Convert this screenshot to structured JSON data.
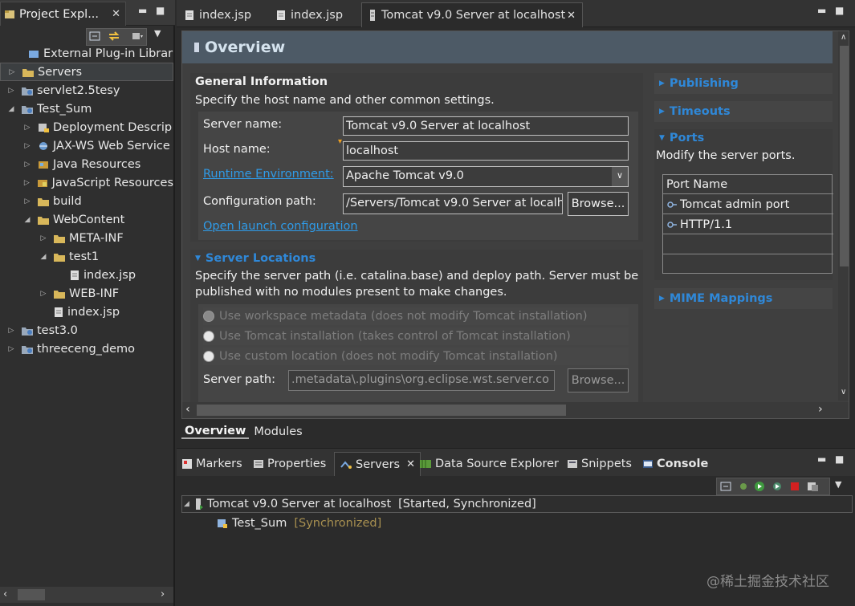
{
  "left_panel": {
    "tab_title": "Project Expl...",
    "tree": [
      {
        "label": "External Plug-in Librarie",
        "icon": "library-icon",
        "arrow": ""
      },
      {
        "label": "Servers",
        "icon": "folder-icon",
        "arrow": "▷",
        "selected": true
      },
      {
        "label": "servlet2.5tesy",
        "icon": "web-project-icon",
        "arrow": "▷"
      },
      {
        "label": "Test_Sum",
        "icon": "web-project-icon",
        "arrow": "◢"
      },
      {
        "label": "Deployment Descrip",
        "icon": "deployment-icon",
        "arrow": "▷"
      },
      {
        "label": "JAX-WS Web Service",
        "icon": "webservice-icon",
        "arrow": "▷"
      },
      {
        "label": "Java Resources",
        "icon": "java-resources-icon",
        "arrow": "▷"
      },
      {
        "label": "JavaScript Resources",
        "icon": "js-resources-icon",
        "arrow": "▷"
      },
      {
        "label": "build",
        "icon": "folder-icon",
        "arrow": "▷"
      },
      {
        "label": "WebContent",
        "icon": "folder-icon",
        "arrow": "◢"
      },
      {
        "label": "META-INF",
        "icon": "folder-icon",
        "arrow": "▷"
      },
      {
        "label": "test1",
        "icon": "folder-icon",
        "arrow": "◢"
      },
      {
        "label": "index.jsp",
        "icon": "jsp-file-icon",
        "arrow": ""
      },
      {
        "label": "WEB-INF",
        "icon": "folder-icon",
        "arrow": "▷"
      },
      {
        "label": "index.jsp",
        "icon": "jsp-file-icon",
        "arrow": ""
      },
      {
        "label": "test3.0",
        "icon": "web-project-icon",
        "arrow": "▷"
      },
      {
        "label": "threeceng_demo",
        "icon": "web-project-icon",
        "arrow": "▷"
      }
    ]
  },
  "editor": {
    "tabs": [
      {
        "label": "index.jsp"
      },
      {
        "label": "index.jsp"
      },
      {
        "label": "Tomcat v9.0 Server at localhost",
        "active": true
      }
    ],
    "overview_title": "Overview",
    "general": {
      "title": "General Information",
      "desc": "Specify the host name and other common settings.",
      "server_name_label": "Server name:",
      "server_name_value": "Tomcat v9.0 Server at localhost",
      "host_name_label": "Host name:",
      "host_name_value": "localhost",
      "runtime_label": "Runtime Environment:",
      "runtime_value": "Apache Tomcat v9.0",
      "config_label": "Configuration path:",
      "config_value": "/Servers/Tomcat v9.0 Server at localh",
      "browse": "Browse...",
      "open_launch": "Open launch configuration"
    },
    "locations": {
      "title": "Server Locations",
      "desc1": "Specify the server path (i.e. catalina.base) and deploy path. Server must be",
      "desc2": "published with no modules present to make changes.",
      "opt1": "Use workspace metadata (does not modify Tomcat installation)",
      "opt2": "Use Tomcat installation (takes control of Tomcat installation)",
      "opt3": "Use custom location (does not modify Tomcat installation)",
      "server_path_label": "Server path:",
      "server_path_value": ".metadata\\.plugins\\org.eclipse.wst.server.co",
      "browse": "Browse..."
    },
    "right": {
      "publishing": "Publishing",
      "timeouts": "Timeouts",
      "ports": "Ports",
      "ports_desc": "Modify the server ports.",
      "port_header": "Port Name",
      "ports_rows": [
        "Tomcat admin port",
        "HTTP/1.1"
      ],
      "mime": "MIME Mappings"
    },
    "bottom_tabs": [
      "Overview",
      "Modules"
    ]
  },
  "bottom": {
    "tabs": [
      {
        "label": "Markers",
        "icon": "markers-icon"
      },
      {
        "label": "Properties",
        "icon": "properties-icon"
      },
      {
        "label": "Servers",
        "icon": "servers-icon",
        "active": true
      },
      {
        "label": "Data Source Explorer",
        "icon": "datasource-icon"
      },
      {
        "label": "Snippets",
        "icon": "snippets-icon"
      },
      {
        "label": "Console",
        "icon": "console-icon"
      }
    ],
    "server_entry": "Tomcat v9.0 Server at localhost",
    "server_status": "[Started, Synchronized]",
    "module_name": "Test_Sum",
    "module_status": "[Synchronized]"
  },
  "watermark": "@稀土掘金技术社区",
  "colors": {
    "link": "#2f9be8",
    "section_title": "#2f88d8",
    "header_bg": "#4d5a66"
  }
}
